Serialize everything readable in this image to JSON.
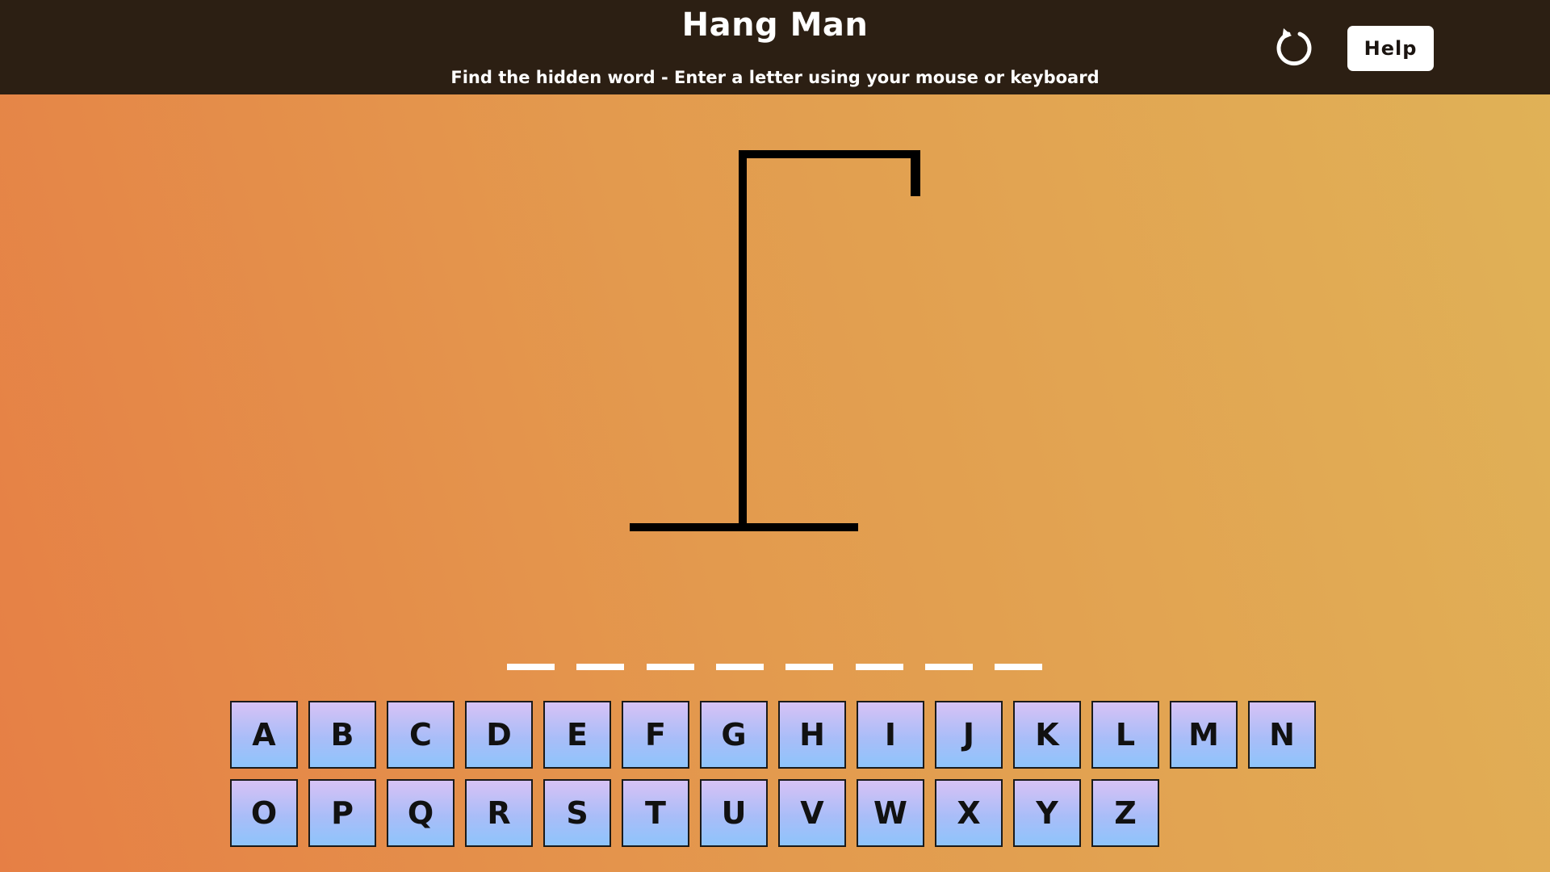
{
  "header": {
    "title": "Hang Man",
    "subtitle": "Find the hidden word - Enter a letter using your mouse or keyboard",
    "help_label": "Help",
    "reset_icon": "reset-icon"
  },
  "game": {
    "word_length": 8,
    "wrong_guesses": 0,
    "blanks": [
      "",
      "",
      "",
      "",
      "",
      "",
      "",
      ""
    ]
  },
  "keyboard": {
    "row1": [
      "A",
      "B",
      "C",
      "D",
      "E",
      "F",
      "G",
      "H",
      "I",
      "J",
      "K",
      "L",
      "M",
      "N"
    ],
    "row2": [
      "O",
      "P",
      "Q",
      "R",
      "S",
      "T",
      "U",
      "V",
      "W",
      "X",
      "Y",
      "Z"
    ]
  },
  "colors": {
    "header_bg": "#2c1f13",
    "bg_left": "#e67f45",
    "bg_right": "#e0b257",
    "key_top": "#d7c2f5",
    "key_bottom": "#8ec4fb"
  }
}
